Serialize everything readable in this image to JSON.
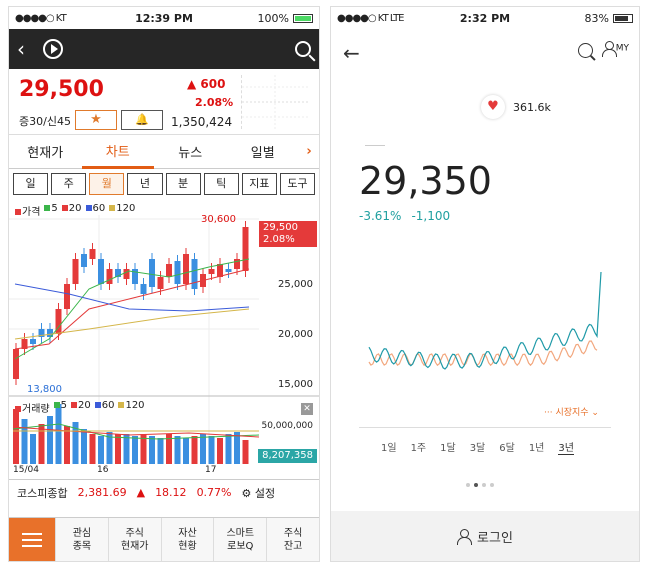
{
  "left": {
    "status": {
      "carrier": "●●●●○ KT",
      "time": "12:39 PM",
      "battery": "100%"
    },
    "quote": {
      "price": "29,500",
      "change": "▲ 600",
      "change_pct": "2.08%",
      "margin": "증30/신45",
      "volume": "1,350,424"
    },
    "tabs": [
      "현재가",
      "차트",
      "뉴스",
      "일별"
    ],
    "periods": [
      "일",
      "주",
      "월",
      "년",
      "분",
      "틱",
      "지표",
      "도구"
    ],
    "chart": {
      "ma_legend": [
        {
          "label": "가격",
          "color": "#e43a3a"
        },
        {
          "label": "5",
          "color": "#3bb54a"
        },
        {
          "label": "20",
          "color": "#e43a3a"
        },
        {
          "label": "60",
          "color": "#3b5bd9"
        },
        {
          "label": "120",
          "color": "#d4b64a"
        }
      ],
      "high_label": "30,600",
      "low_label": "13,800",
      "last_price_tag": "29,500",
      "last_pct_tag": "2.08%",
      "y_ticks": [
        "25,000",
        "20,000",
        "15,000"
      ],
      "x_ticks": [
        "15/04",
        "16",
        "17"
      ],
      "vol_legend": [
        {
          "label": "거래량",
          "color": "#e43a3a"
        },
        {
          "label": "5",
          "color": "#3bb54a"
        },
        {
          "label": "20",
          "color": "#e43a3a"
        },
        {
          "label": "60",
          "color": "#3b5bd9"
        },
        {
          "label": "120",
          "color": "#d4b64a"
        }
      ],
      "vol_scale": "50,000,000",
      "vol_tag": "8,207,358"
    },
    "index": {
      "name": "코스피종합",
      "value": "2,381.69",
      "change": "18.12",
      "pct": "0.77%",
      "settings": "설정"
    },
    "bottom_nav": [
      "관심\n종목",
      "주식\n현재가",
      "자산\n현황",
      "스마트\n로보Q",
      "주식\n잔고"
    ]
  },
  "right": {
    "status": {
      "carrier": "●●●●○ KT  LTE",
      "time": "2:32 PM",
      "battery": "83%"
    },
    "likes": "361.6k",
    "price": "29,350",
    "change_pct": "-3.61%",
    "change": "-1,100",
    "index_legend": "··· 시장지수 ⌄",
    "ranges": [
      "1일",
      "1주",
      "1달",
      "3달",
      "6달",
      "1년",
      "3년"
    ],
    "login": "로그인",
    "my_label": "MY"
  }
}
